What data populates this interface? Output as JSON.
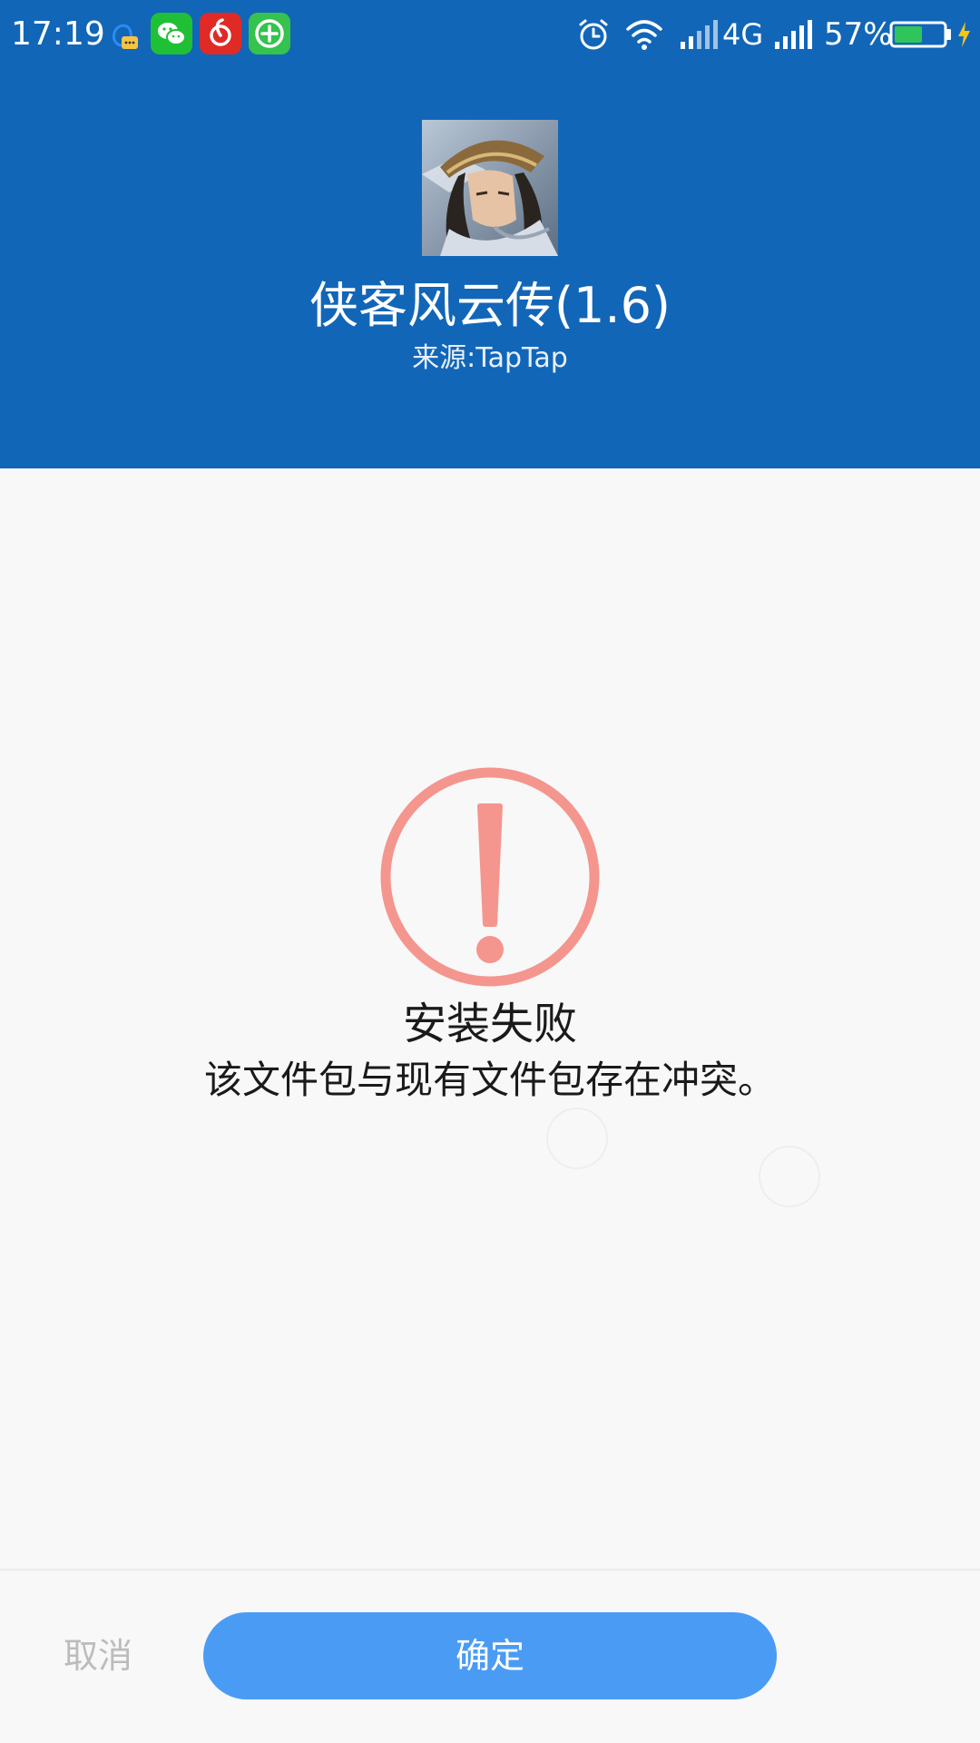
{
  "status_bar": {
    "time": "17:19",
    "network": "4G",
    "battery_percent": "57%",
    "battery_level": 0.57,
    "icons": [
      "qq-icon",
      "wechat-icon",
      "netease-music-icon",
      "green-plus-app-icon",
      "alarm-icon",
      "wifi-icon",
      "signal-icon",
      "signal-icon",
      "battery-icon",
      "charging-icon"
    ]
  },
  "app": {
    "name": "侠客风云传(1.6)",
    "source": "来源:TapTap"
  },
  "result": {
    "title": "安装失败",
    "description": "该文件包与现有文件包存在冲突。",
    "icon": "exclamation-circle-icon",
    "icon_color": "#f4968e"
  },
  "actions": {
    "cancel_label": "取消",
    "confirm_label": "确定"
  },
  "colors": {
    "header": "#1266b8",
    "confirm_button": "#4a9bf4",
    "background": "#f8f8f9"
  }
}
